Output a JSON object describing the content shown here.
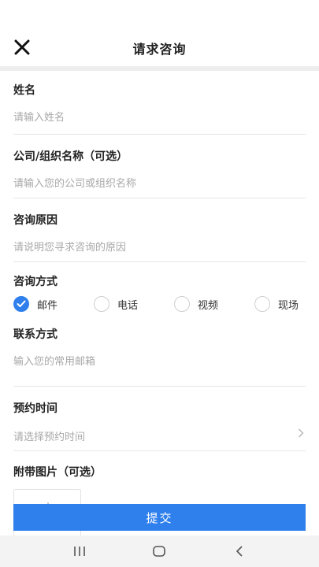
{
  "header": {
    "title": "请求咨询"
  },
  "form": {
    "name": {
      "label": "姓名",
      "placeholder": "请输入姓名"
    },
    "company": {
      "label": "公司/组织名称（可选）",
      "placeholder": "请输入您的公司或组织名称"
    },
    "reason": {
      "label": "咨询原因",
      "placeholder": "请说明您寻求咨询的原因"
    },
    "method": {
      "label": "咨询方式",
      "options": [
        {
          "label": "邮件",
          "checked": true
        },
        {
          "label": "电话",
          "checked": false
        },
        {
          "label": "视频",
          "checked": false
        },
        {
          "label": "现场",
          "checked": false
        }
      ]
    },
    "contact": {
      "label": "联系方式",
      "placeholder": "输入您的常用邮箱"
    },
    "time": {
      "label": "预约时间",
      "placeholder": "请选择预约时间"
    },
    "image": {
      "label": "附带图片（可选）"
    }
  },
  "submit": {
    "label": "提交"
  },
  "colors": {
    "accent": "#2f80ed",
    "placeholder": "#a8a8a8",
    "divider": "#e6e6e6"
  },
  "icons": [
    "close-icon",
    "check-icon",
    "chevron-right-icon",
    "recent-apps-icon",
    "home-icon",
    "back-icon"
  ]
}
